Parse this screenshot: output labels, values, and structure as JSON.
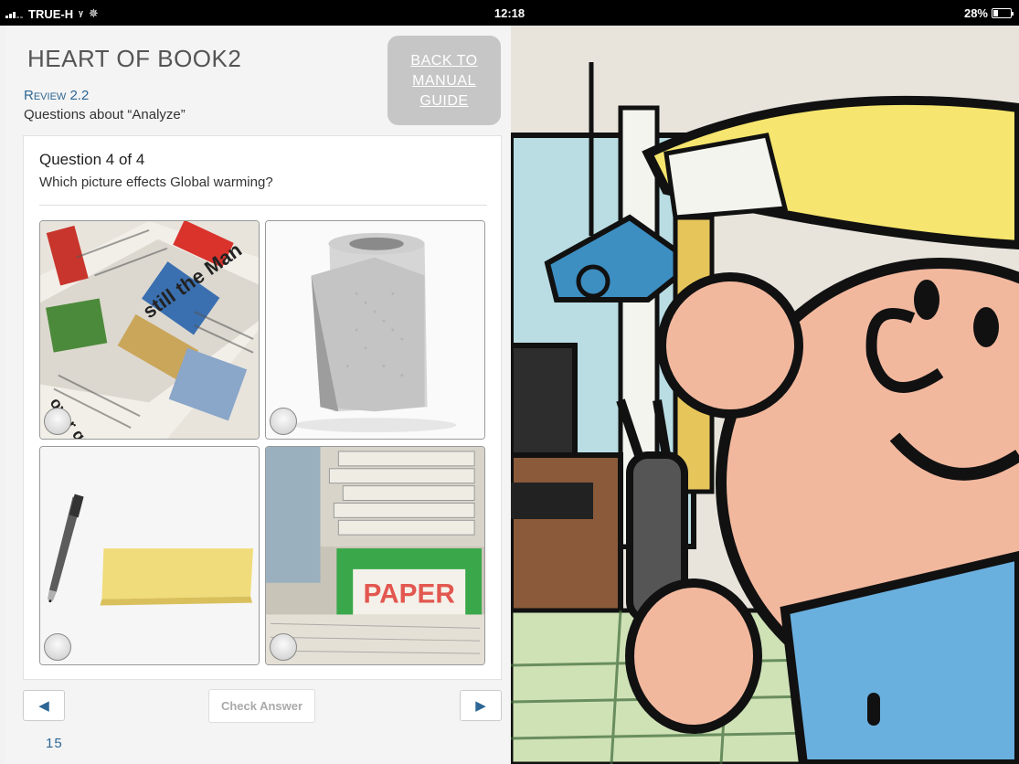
{
  "status_bar": {
    "carrier": "TRUE-H",
    "time": "12:18",
    "battery": "28%"
  },
  "header": {
    "book_title": "HEART OF BOOK2",
    "review_label": "Review 2.2",
    "review_subtitle": "Questions about “Analyze”",
    "back_button_lines": [
      "BACK TO",
      "MANUAL",
      "GUIDE"
    ]
  },
  "question": {
    "counter": "Question 4 of 4",
    "text": "Which picture effects Global warming?",
    "options": [
      {
        "id": "newspapers",
        "selected": false
      },
      {
        "id": "paper-towel-roll",
        "selected": false
      },
      {
        "id": "pen-and-sticky-notes",
        "selected": false
      },
      {
        "id": "recycling-paper-bin",
        "selected": false
      }
    ],
    "option_image_text": {
      "paper_sign": "PAPER"
    }
  },
  "footer": {
    "prev_icon": "triangle-left-icon",
    "next_icon": "triangle-right-icon",
    "check_answer_label": "Check Answer",
    "page_number": "15"
  },
  "colors": {
    "accent": "#2d6694",
    "back_button_bg": "#c6c6c6",
    "status_bar_bg": "#000000"
  }
}
